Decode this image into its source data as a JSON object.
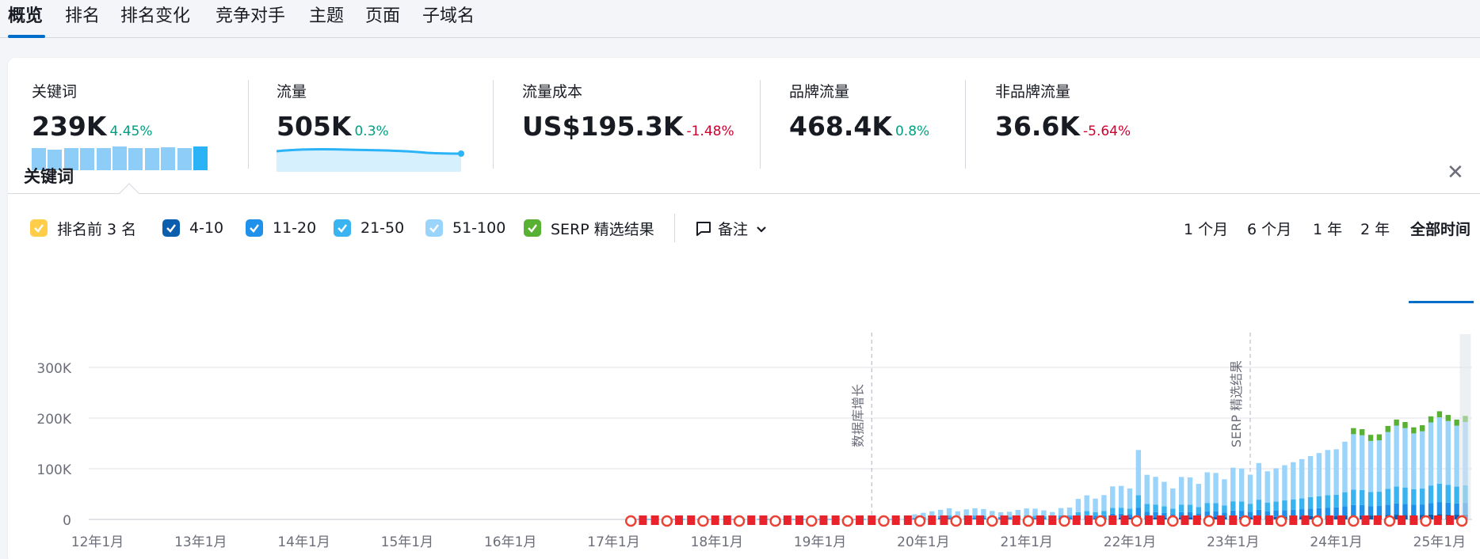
{
  "tabs": [
    "概览",
    "排名",
    "排名变化",
    "竞争对手",
    "主题",
    "页面",
    "子域名"
  ],
  "kpis": {
    "keywords": {
      "label": "关键词",
      "value": "239K",
      "delta": "4.45%"
    },
    "traffic": {
      "label": "流量",
      "value": "505K",
      "delta": "0.3%"
    },
    "traffic_cost": {
      "label": "流量成本",
      "value": "US$195.3K",
      "delta": "-1.48%"
    },
    "brand_traffic": {
      "label": "品牌流量",
      "value": "468.4K",
      "delta": "0.8%"
    },
    "nonbrand_traffic": {
      "label": "非品牌流量",
      "value": "36.6K",
      "delta": "-5.64%"
    }
  },
  "keywords_sparkline": [
    0.92,
    0.88,
    0.92,
    0.92,
    0.95,
    1.0,
    0.95,
    0.92,
    0.96,
    0.95,
    1.0
  ],
  "section_title": "关键词",
  "legend": [
    {
      "label": "排名前 3 名",
      "color": "#ffcd48",
      "checked": true
    },
    {
      "label": "4-10",
      "color": "#0a5ead",
      "checked": true
    },
    {
      "label": "11-20",
      "color": "#1f91eb",
      "checked": true
    },
    {
      "label": "21-50",
      "color": "#3ab4f1",
      "checked": true
    },
    {
      "label": "51-100",
      "color": "#9bd4fa",
      "checked": true
    },
    {
      "label": "SERP 精选结果",
      "color": "#59b133",
      "checked": true
    }
  ],
  "notes_label": "备注",
  "time_ranges": [
    "1 个月",
    "6 个月",
    "1 年",
    "2 年",
    "全部时间"
  ],
  "active_range": "全部时间",
  "chart_data": {
    "type": "bar",
    "y_ticks": [
      "0",
      "100K",
      "200K",
      "300K"
    ],
    "ylim": [
      0,
      340000
    ],
    "x_ticks": [
      "12年1月",
      "13年1月",
      "14年1月",
      "15年1月",
      "16年1月",
      "17年1月",
      "18年1月",
      "19年1月",
      "20年1月",
      "21年1月",
      "22年1月",
      "23年1月",
      "24年1月",
      "25年1月"
    ],
    "annotations": [
      {
        "label": "数据库增长",
        "x": "19年7月"
      },
      {
        "label": "SERP 精选结果",
        "x": "23年3月"
      }
    ],
    "series_colors": {
      "4-10": "#0a5ead",
      "11-20": "#1f91eb",
      "21-50": "#3ab4f1",
      "51-100": "#9bd4fa",
      "SERP 精选结果": "#59b133"
    }
  }
}
